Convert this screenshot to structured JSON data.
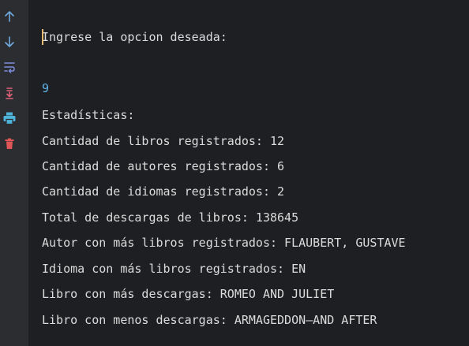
{
  "toolbar": {
    "icons": [
      {
        "name": "scroll-up-icon",
        "color": "#6fa8dc"
      },
      {
        "name": "scroll-down-icon",
        "color": "#6fa8dc"
      },
      {
        "name": "soft-wrap-icon",
        "color": "#7f8fe0"
      },
      {
        "name": "scroll-to-end-icon",
        "color": "#e0607a"
      },
      {
        "name": "print-icon",
        "color": "#4fb3d9"
      },
      {
        "name": "clear-all-icon",
        "color": "#e05555"
      }
    ]
  },
  "console": {
    "prompt": "Ingrese la opcion deseada:",
    "user_input": "9",
    "lines": [
      "Estadísticas:",
      "Cantidad de libros registrados: 12",
      "Cantidad de autores registrados: 6",
      "Cantidad de idiomas registrados: 2",
      "Total de descargas de libros: 138645",
      "Autor con más libros registrados: FLAUBERT, GUSTAVE",
      "Idioma con más libros registrados: EN",
      "Libro con más descargas: ROMEO AND JULIET",
      "Libro con menos descargas: ARMAGEDDON—AND AFTER"
    ]
  },
  "colors": {
    "background": "#1e1f22",
    "gutter": "#2b2d30",
    "text": "#dcdcdc",
    "input_text": "#5fb3e4",
    "caret": "#e8b86d"
  }
}
